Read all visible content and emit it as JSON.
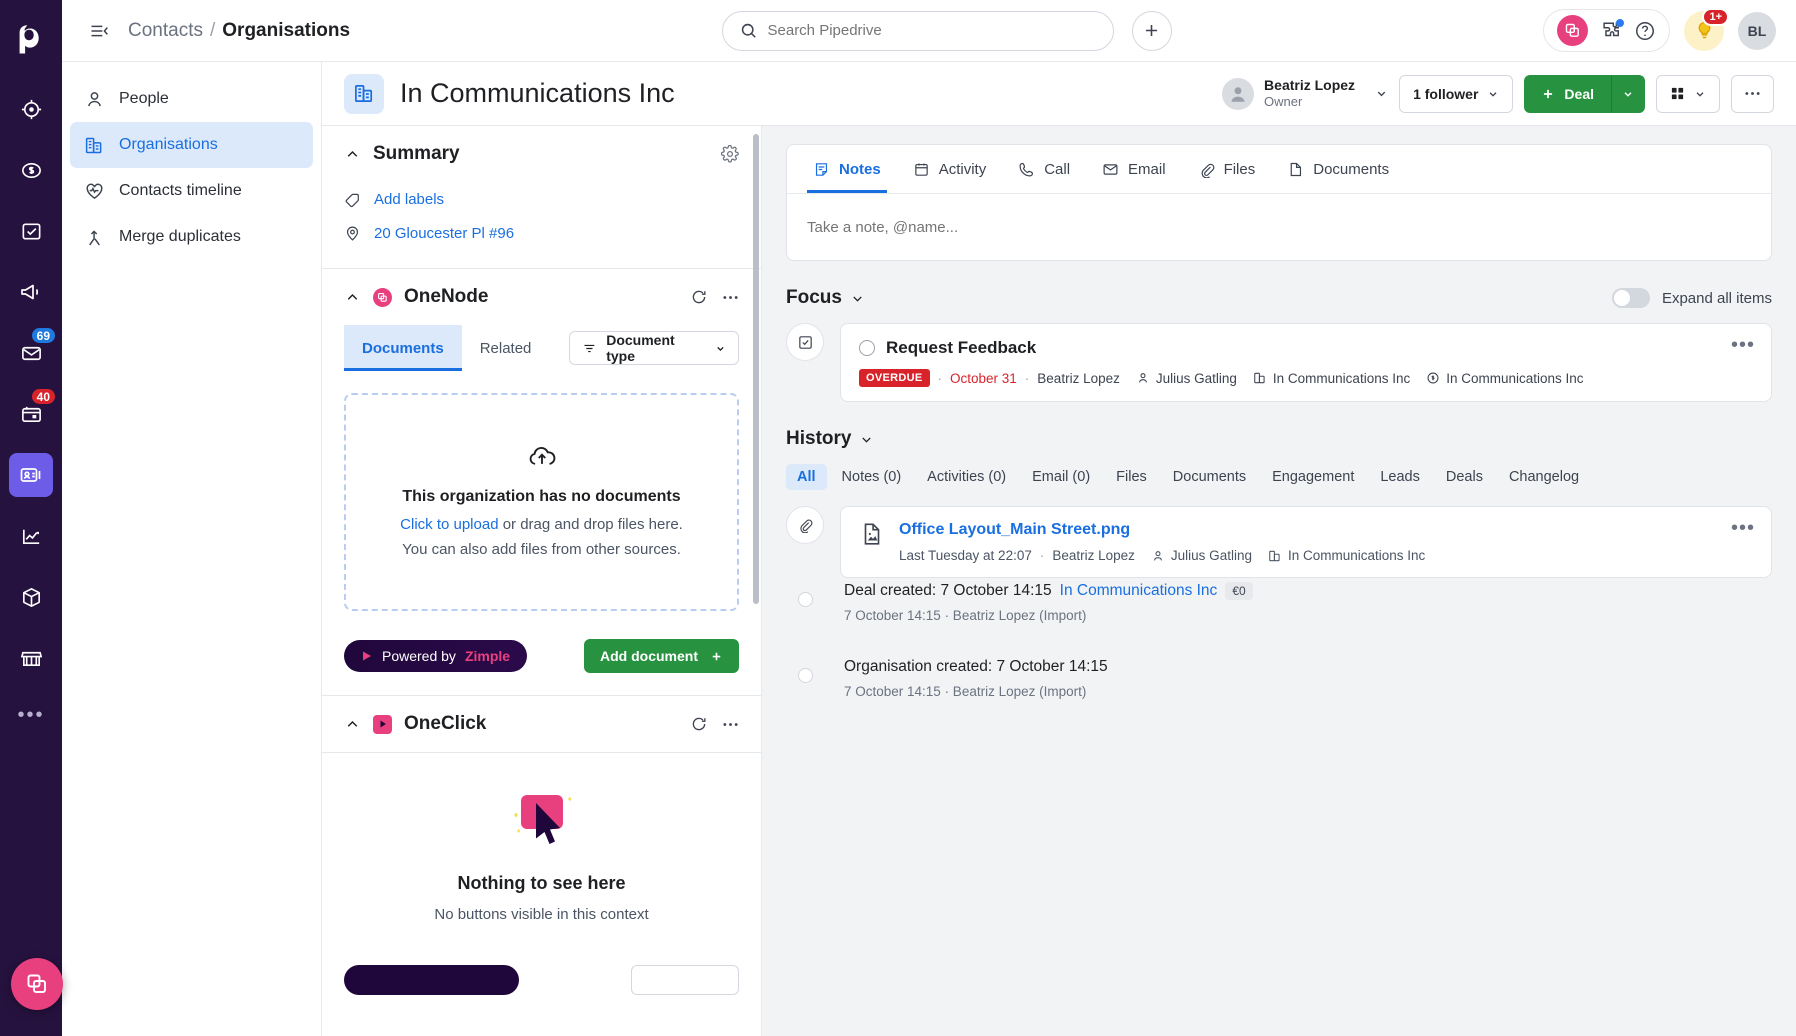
{
  "brand": {
    "accent": "#1a6fe0",
    "green": "#27923f",
    "pink": "#e8407e",
    "red": "#d8232a",
    "rail_bg": "#26123f"
  },
  "rail": {
    "logo": "pipedrive-logo",
    "items": [
      {
        "name": "leads-icon",
        "badge": null
      },
      {
        "name": "deals-icon",
        "badge": null
      },
      {
        "name": "activities-icon",
        "badge": null
      },
      {
        "name": "campaigns-icon",
        "badge": null
      },
      {
        "name": "mail-icon",
        "badge": "69"
      },
      {
        "name": "calendar-icon",
        "badge": "40"
      },
      {
        "name": "contacts-icon",
        "badge": null
      },
      {
        "name": "insights-icon",
        "badge": null
      },
      {
        "name": "products-icon",
        "badge": null
      },
      {
        "name": "marketplace-icon",
        "badge": null
      }
    ],
    "more": "•••"
  },
  "topbar": {
    "breadcrumb_parent": "Contacts",
    "breadcrumb_sep": "/",
    "breadcrumb_current": "Organisations",
    "search_placeholder": "Search Pipedrive",
    "search_value": "",
    "bulb_badge": "1+",
    "avatar_initials": "BL"
  },
  "subnav": {
    "items": [
      {
        "label": "People",
        "icon": "person-icon",
        "active": false
      },
      {
        "label": "Organisations",
        "icon": "organisation-icon",
        "active": true
      },
      {
        "label": "Contacts timeline",
        "icon": "heart-pulse-icon",
        "active": false
      },
      {
        "label": "Merge duplicates",
        "icon": "merge-icon",
        "active": false
      }
    ]
  },
  "detail_header": {
    "title": "In Communications Inc",
    "owner_name": "Beatriz Lopez",
    "owner_role": "Owner",
    "followers_label": "1 follower",
    "deal_label": "Deal",
    "deal_plus": "+"
  },
  "left_pane": {
    "summary": {
      "title": "Summary",
      "rows": [
        {
          "label": "Add labels",
          "icon": "tag-icon"
        },
        {
          "label": "20 Gloucester Pl #96",
          "icon": "location-pin-icon"
        }
      ]
    },
    "onenode": {
      "title": "OneNode",
      "tabs": [
        {
          "label": "Documents",
          "active": true
        },
        {
          "label": "Related",
          "active": false
        }
      ],
      "filter_label": "Document type",
      "dropzone": {
        "title": "This organization has no documents",
        "link": "Click to upload",
        "line1_rest": " or drag and drop files here.",
        "line2": "You can also add files from other sources."
      },
      "powered_prefix": "Powered by ",
      "powered_name": "Zimple",
      "add_document": "Add document"
    },
    "oneclick": {
      "title": "OneClick",
      "empty_title": "Nothing to see here",
      "empty_sub": "No buttons visible in this context"
    }
  },
  "right_pane": {
    "note_tabs": [
      {
        "label": "Notes",
        "icon": "note-icon",
        "active": true
      },
      {
        "label": "Activity",
        "icon": "calendar-icon",
        "active": false
      },
      {
        "label": "Call",
        "icon": "phone-icon",
        "active": false
      },
      {
        "label": "Email",
        "icon": "envelope-icon",
        "active": false
      },
      {
        "label": "Files",
        "icon": "paperclip-icon",
        "active": false
      },
      {
        "label": "Documents",
        "icon": "document-icon",
        "active": false
      }
    ],
    "note_placeholder": "Take a note, @name...",
    "focus": {
      "title": "Focus",
      "expand_label": "Expand all items",
      "activity": {
        "title": "Request Feedback",
        "badge": "OVERDUE",
        "date": "October 31",
        "owner": "Beatriz Lopez",
        "person": "Julius Gatling",
        "org": "In Communications Inc",
        "deal": "In Communications Inc",
        "sep": "·",
        "menu": "•••"
      }
    },
    "history": {
      "title": "History",
      "tabs": [
        {
          "label": "All",
          "active": true
        },
        {
          "label": "Notes (0)",
          "active": false
        },
        {
          "label": "Activities (0)",
          "active": false
        },
        {
          "label": "Email (0)",
          "active": false
        },
        {
          "label": "Files",
          "active": false
        },
        {
          "label": "Documents",
          "active": false
        },
        {
          "label": "Engagement",
          "active": false
        },
        {
          "label": "Leads",
          "active": false
        },
        {
          "label": "Deals",
          "active": false
        },
        {
          "label": "Changelog",
          "active": false
        }
      ],
      "file_entry": {
        "name": "Office Layout_Main Street.png",
        "time": "Last Tuesday at 22:07",
        "sep": "·",
        "author": "Beatriz Lopez",
        "person": "Julius Gatling",
        "org": "In Communications Inc",
        "menu": "•••"
      },
      "events": [
        {
          "title": "Deal created: 7 October 14:15 ",
          "link": "In Communications Inc",
          "chip": "€0",
          "sub": "7 October 14:15 · Beatriz Lopez (Import)"
        },
        {
          "title": "Organisation created: 7 October 14:15",
          "link": "",
          "chip": "",
          "sub": "7 October 14:15 · Beatriz Lopez (Import)"
        }
      ]
    }
  }
}
